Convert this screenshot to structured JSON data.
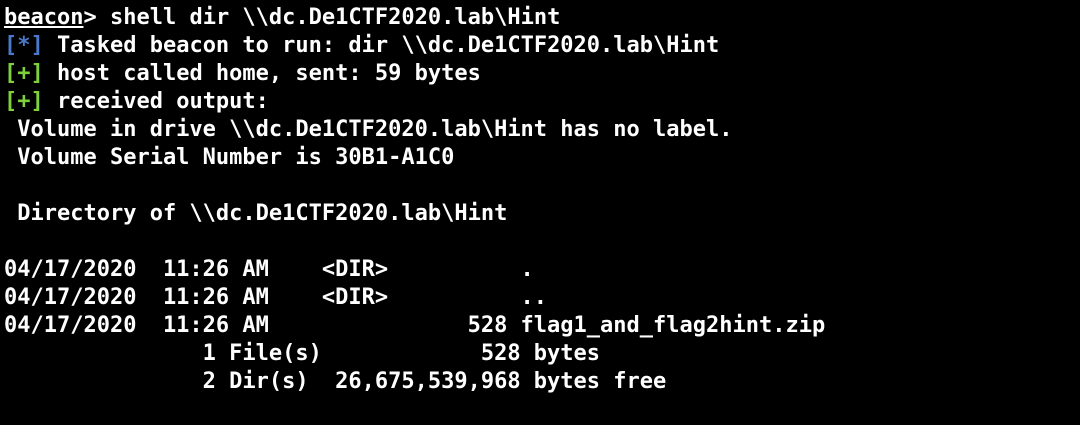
{
  "colors": {
    "background": "#000000",
    "text": "#ffffff",
    "info_marker": "#4a79c9",
    "success_marker": "#7fd13b"
  },
  "prompt": {
    "name": "beacon",
    "symbol": ">",
    "command": " shell dir \\\\dc.De1CTF2020.lab\\Hint"
  },
  "messages": [
    {
      "marker": "[*]",
      "text": " Tasked beacon to run: dir \\\\dc.De1CTF2020.lab\\Hint"
    },
    {
      "marker": "[+]",
      "text": " host called home, sent: 59 bytes"
    },
    {
      "marker": "[+]",
      "text": " received output:"
    }
  ],
  "output": {
    "volume_label": " Volume in drive \\\\dc.De1CTF2020.lab\\Hint has no label.",
    "volume_serial": " Volume Serial Number is 30B1-A1C0",
    "directory_of": " Directory of \\\\dc.De1CTF2020.lab\\Hint",
    "entries": [
      "04/17/2020  11:26 AM    <DIR>          .",
      "04/17/2020  11:26 AM    <DIR>          ..",
      "04/17/2020  11:26 AM               528 flag1_and_flag2hint.zip"
    ],
    "summary_files": "               1 File(s)            528 bytes",
    "summary_dirs": "               2 Dir(s)  26,675,539,968 bytes free"
  }
}
